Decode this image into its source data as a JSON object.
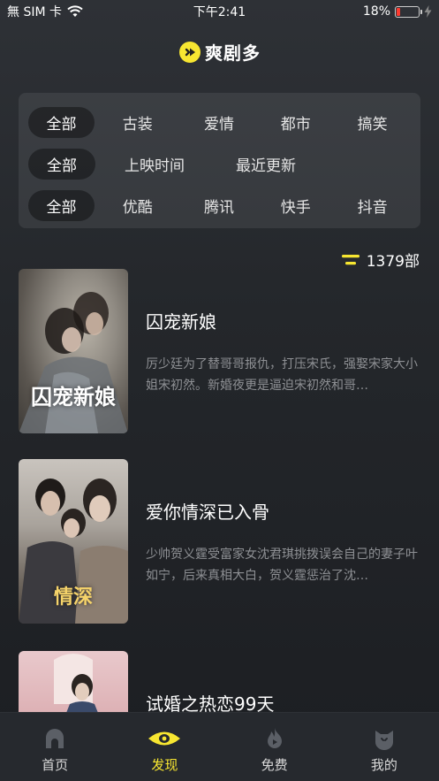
{
  "status_bar": {
    "carrier": "無 SIM 卡",
    "time": "下午2:41",
    "battery_percent": "18%",
    "battery_level": 0.18,
    "battery_color": "#ff3b30"
  },
  "brand": {
    "name": "爽剧多",
    "logo_icon": "play-circle-icon",
    "accent_color": "#f7e631"
  },
  "filters": {
    "genre": [
      "全部",
      "古装",
      "爱情",
      "都市",
      "搞笑"
    ],
    "sort": [
      "全部",
      "上映时间",
      "最近更新"
    ],
    "platform": [
      "全部",
      "优酷",
      "腾讯",
      "快手",
      "抖音"
    ],
    "selected": {
      "genre": "全部",
      "sort": "全部",
      "platform": "全部"
    }
  },
  "result_count": "1379部",
  "dramas": [
    {
      "title": "囚宠新娘",
      "poster_title": "囚宠新娘",
      "description": "厉少廷为了替哥哥报仇，打压宋氏，强娶宋家大小姐宋初然。新婚夜更是逼迫宋初然和哥…"
    },
    {
      "title": "爱你情深已入骨",
      "poster_title": "情深",
      "description": "少帅贺义霆受富家女沈君琪挑拨误会自己的妻子叶如宁，后来真相大白，贺义霆惩治了沈…"
    },
    {
      "title": "试婚之热恋99天",
      "poster_title": "",
      "description": ""
    }
  ],
  "tab_bar": {
    "tabs": [
      {
        "label": "首页",
        "icon": "home-icon"
      },
      {
        "label": "发现",
        "icon": "eye-icon",
        "active": true
      },
      {
        "label": "免费",
        "icon": "fire-icon"
      },
      {
        "label": "我的",
        "icon": "cat-face-icon"
      }
    ]
  }
}
